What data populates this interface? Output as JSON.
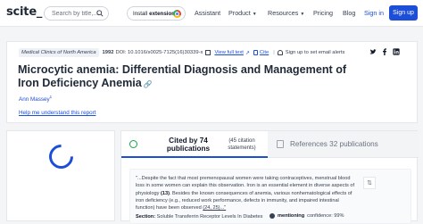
{
  "header": {
    "logo": "scite_",
    "search_placeholder": "Search by title,...",
    "extension_label_prefix": "Install",
    "extension_label_bold": "extension!",
    "nav": [
      {
        "label": "Assistant",
        "dropdown": false
      },
      {
        "label": "Product",
        "dropdown": true
      },
      {
        "label": "Resources",
        "dropdown": true
      },
      {
        "label": "Pricing",
        "dropdown": false
      },
      {
        "label": "Blog",
        "dropdown": false
      }
    ],
    "sign_in": "Sign in",
    "sign_up": "Sign up"
  },
  "article": {
    "journal": "Medical Clinics of North America",
    "year": "1992",
    "doi": "DOI: 10.1016/s0025-7125(16)30339-x",
    "view_full_text": "View full text",
    "cite": "Cite",
    "alert": "Sign up to set email alerts",
    "title": "Microcytic anemia: Differential Diagnosis and Management of Iron Deficiency Anemia",
    "author": "Ann Massey",
    "author_sup": "1",
    "help_link": "Help me understand this report"
  },
  "citations": {
    "cited_by": "Cited by 74 publications",
    "citation_statements": "(45 citation statements)",
    "references": "References 32 publications",
    "quote_pre": "\"...Despite the fact that most premenopausal women were taking contraceptives, menstrual blood loss in some women can explain this observation. Iron is an essential element in diverse aspects of physiology ",
    "quote_ref": "(13)",
    "quote_mid": ". Besides the known consequences of anemia, various nonhematological effects of iron deficiency (e.g., reduced work performance, defects in immunity, and impaired intestinal function) have been observed ",
    "quote_tail": "(24, 25)...\"",
    "section_label": "Section:",
    "section_value": "Soluble Transferrin Receptor Levels In Diabetes",
    "type_label": "mentioning",
    "confidence": "confidence: 99%"
  },
  "colors": {
    "brand": "#1d4ed8",
    "green": "#16a34a"
  }
}
